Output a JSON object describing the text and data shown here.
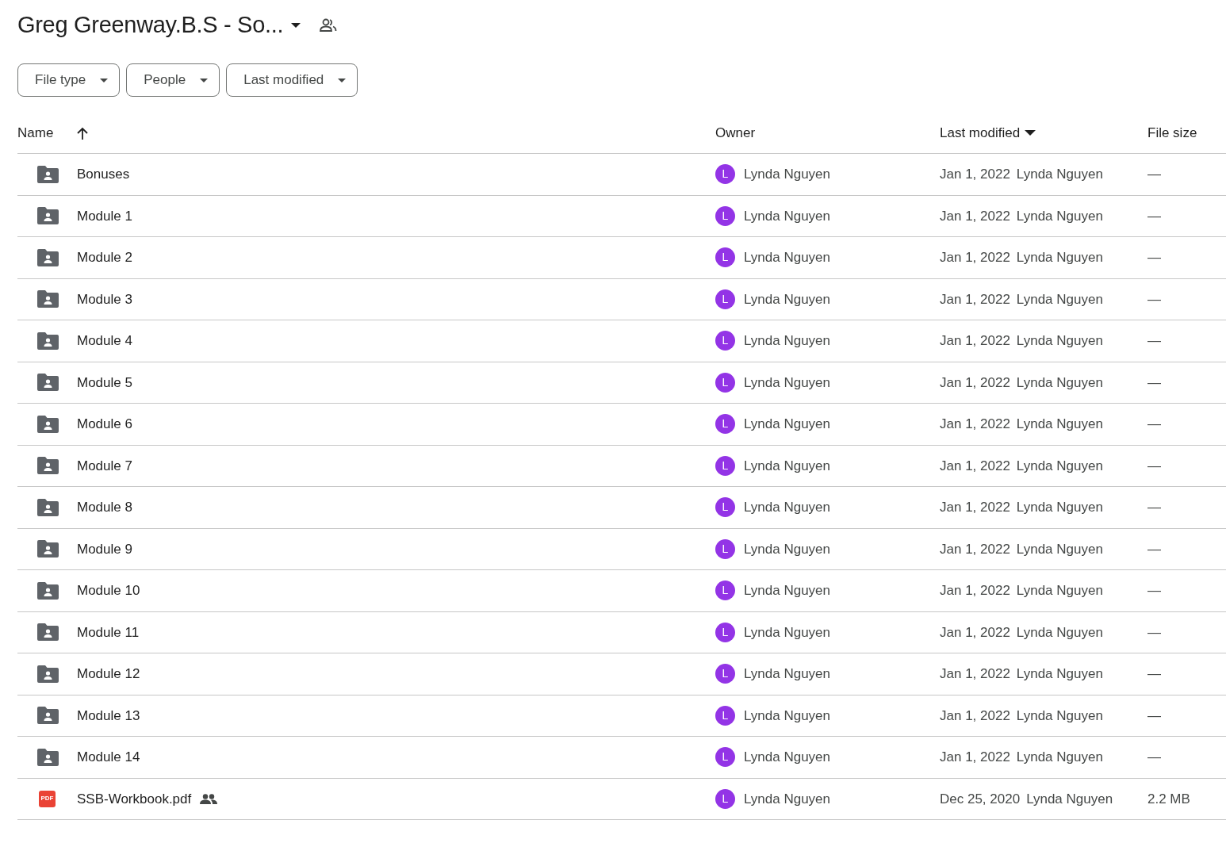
{
  "title": "Greg Greenway.B.S - So...",
  "filters": [
    {
      "label": "File type"
    },
    {
      "label": "People"
    },
    {
      "label": "Last modified"
    }
  ],
  "columns": [
    {
      "label": "Name",
      "sorted": true,
      "descending": false
    },
    {
      "label": "Owner",
      "sorted": false
    },
    {
      "label": "Last modified",
      "sorted": true,
      "descending": true
    },
    {
      "label": "File size",
      "sorted": false
    }
  ],
  "rows": [
    {
      "kind": "folder",
      "name": "Bonuses",
      "shared": false,
      "owner_initial": "L",
      "owner": "Lynda Nguyen",
      "modified": "Jan 1, 2022",
      "modified_by": "Lynda Nguyen",
      "size": "—"
    },
    {
      "kind": "folder",
      "name": "Module 1",
      "shared": false,
      "owner_initial": "L",
      "owner": "Lynda Nguyen",
      "modified": "Jan 1, 2022",
      "modified_by": "Lynda Nguyen",
      "size": "—"
    },
    {
      "kind": "folder",
      "name": "Module 2",
      "shared": false,
      "owner_initial": "L",
      "owner": "Lynda Nguyen",
      "modified": "Jan 1, 2022",
      "modified_by": "Lynda Nguyen",
      "size": "—"
    },
    {
      "kind": "folder",
      "name": "Module 3",
      "shared": false,
      "owner_initial": "L",
      "owner": "Lynda Nguyen",
      "modified": "Jan 1, 2022",
      "modified_by": "Lynda Nguyen",
      "size": "—"
    },
    {
      "kind": "folder",
      "name": "Module 4",
      "shared": false,
      "owner_initial": "L",
      "owner": "Lynda Nguyen",
      "modified": "Jan 1, 2022",
      "modified_by": "Lynda Nguyen",
      "size": "—"
    },
    {
      "kind": "folder",
      "name": "Module 5",
      "shared": false,
      "owner_initial": "L",
      "owner": "Lynda Nguyen",
      "modified": "Jan 1, 2022",
      "modified_by": "Lynda Nguyen",
      "size": "—"
    },
    {
      "kind": "folder",
      "name": "Module 6",
      "shared": false,
      "owner_initial": "L",
      "owner": "Lynda Nguyen",
      "modified": "Jan 1, 2022",
      "modified_by": "Lynda Nguyen",
      "size": "—"
    },
    {
      "kind": "folder",
      "name": "Module 7",
      "shared": false,
      "owner_initial": "L",
      "owner": "Lynda Nguyen",
      "modified": "Jan 1, 2022",
      "modified_by": "Lynda Nguyen",
      "size": "—"
    },
    {
      "kind": "folder",
      "name": "Module 8",
      "shared": false,
      "owner_initial": "L",
      "owner": "Lynda Nguyen",
      "modified": "Jan 1, 2022",
      "modified_by": "Lynda Nguyen",
      "size": "—"
    },
    {
      "kind": "folder",
      "name": "Module 9",
      "shared": false,
      "owner_initial": "L",
      "owner": "Lynda Nguyen",
      "modified": "Jan 1, 2022",
      "modified_by": "Lynda Nguyen",
      "size": "—"
    },
    {
      "kind": "folder",
      "name": "Module 10",
      "shared": false,
      "owner_initial": "L",
      "owner": "Lynda Nguyen",
      "modified": "Jan 1, 2022",
      "modified_by": "Lynda Nguyen",
      "size": "—"
    },
    {
      "kind": "folder",
      "name": "Module 11",
      "shared": false,
      "owner_initial": "L",
      "owner": "Lynda Nguyen",
      "modified": "Jan 1, 2022",
      "modified_by": "Lynda Nguyen",
      "size": "—"
    },
    {
      "kind": "folder",
      "name": "Module 12",
      "shared": false,
      "owner_initial": "L",
      "owner": "Lynda Nguyen",
      "modified": "Jan 1, 2022",
      "modified_by": "Lynda Nguyen",
      "size": "—"
    },
    {
      "kind": "folder",
      "name": "Module 13",
      "shared": false,
      "owner_initial": "L",
      "owner": "Lynda Nguyen",
      "modified": "Jan 1, 2022",
      "modified_by": "Lynda Nguyen",
      "size": "—"
    },
    {
      "kind": "folder",
      "name": "Module 14",
      "shared": false,
      "owner_initial": "L",
      "owner": "Lynda Nguyen",
      "modified": "Jan 1, 2022",
      "modified_by": "Lynda Nguyen",
      "size": "—"
    },
    {
      "kind": "pdf",
      "icon_text": "PDF",
      "name": "SSB-Workbook.pdf",
      "shared": true,
      "owner_initial": "L",
      "owner": "Lynda Nguyen",
      "modified": "Dec 25, 2020",
      "modified_by": "Lynda Nguyen",
      "size": "2.2 MB"
    }
  ]
}
